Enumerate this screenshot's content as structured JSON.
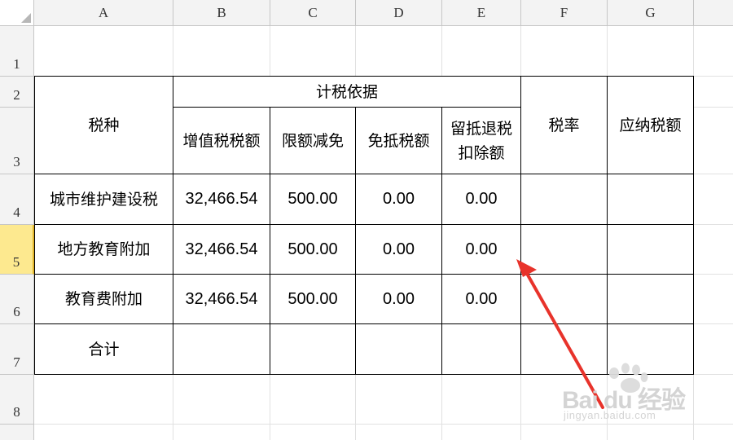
{
  "column_headers": [
    "A",
    "B",
    "C",
    "D",
    "E",
    "F",
    "G"
  ],
  "row_headers": [
    "1",
    "2",
    "3",
    "4",
    "5",
    "6",
    "7",
    "8"
  ],
  "selected_row": "5",
  "table": {
    "header_tax_type": "税种",
    "header_basis": "计税依据",
    "header_vat": "增值税税额",
    "header_quota": "限额减免",
    "header_exempt": "免抵税额",
    "header_refund_line1": "留抵退税",
    "header_refund_line2": "扣除额",
    "header_rate": "税率",
    "header_payable": "应纳税额",
    "rows": [
      {
        "name": "城市维护建设税",
        "vat": "32,466.54",
        "quota": "500.00",
        "exempt": "0.00",
        "refund": "0.00"
      },
      {
        "name": "地方教育附加",
        "vat": "32,466.54",
        "quota": "500.00",
        "exempt": "0.00",
        "refund": "0.00"
      },
      {
        "name": "教育费附加",
        "vat": "32,466.54",
        "quota": "500.00",
        "exempt": "0.00",
        "refund": "0.00"
      },
      {
        "name": "合计",
        "vat": "",
        "quota": "",
        "exempt": "",
        "refund": ""
      }
    ]
  },
  "annotation": {
    "arrow_color": "#e8332b"
  },
  "watermark": {
    "logo_text": "Bai du 经验",
    "url_text": "jingyan.baidu.com"
  }
}
